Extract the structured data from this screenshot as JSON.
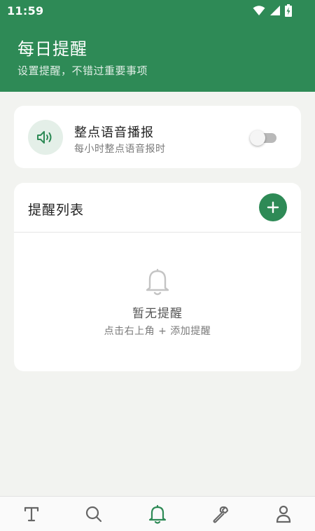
{
  "status_bar": {
    "time": "11:59"
  },
  "header": {
    "title": "每日提醒",
    "subtitle": "设置提醒，不错过重要事项"
  },
  "hourly_announcement": {
    "title": "整点语音播报",
    "description": "每小时整点语音报时",
    "enabled": false
  },
  "reminder_list": {
    "title": "提醒列表",
    "empty_title": "暂无提醒",
    "empty_hint": "点击右上角 + 添加提醒",
    "items": []
  },
  "bottom_nav": {
    "items": [
      {
        "icon": "text-icon",
        "active": false
      },
      {
        "icon": "search-icon",
        "active": false
      },
      {
        "icon": "bell-icon",
        "active": true
      },
      {
        "icon": "wrench-icon",
        "active": false
      },
      {
        "icon": "user-icon",
        "active": false
      }
    ]
  },
  "colors": {
    "primary": "#2e8a56",
    "background": "#f2f3f0",
    "card": "#ffffff",
    "icon_inactive": "#666666"
  }
}
